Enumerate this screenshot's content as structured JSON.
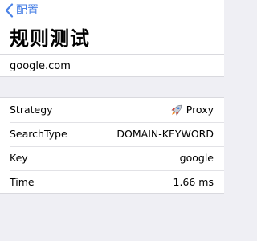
{
  "nav": {
    "back_label": "配置",
    "title": "规则测试"
  },
  "domain": "google.com",
  "accent_color": "#4b82e6",
  "details": [
    {
      "label": "Strategy",
      "value": "Proxy",
      "icon": "rocket-icon"
    },
    {
      "label": "SearchType",
      "value": "DOMAIN-KEYWORD"
    },
    {
      "label": "Key",
      "value": "google"
    },
    {
      "label": "Time",
      "value": "1.66 ms"
    }
  ]
}
